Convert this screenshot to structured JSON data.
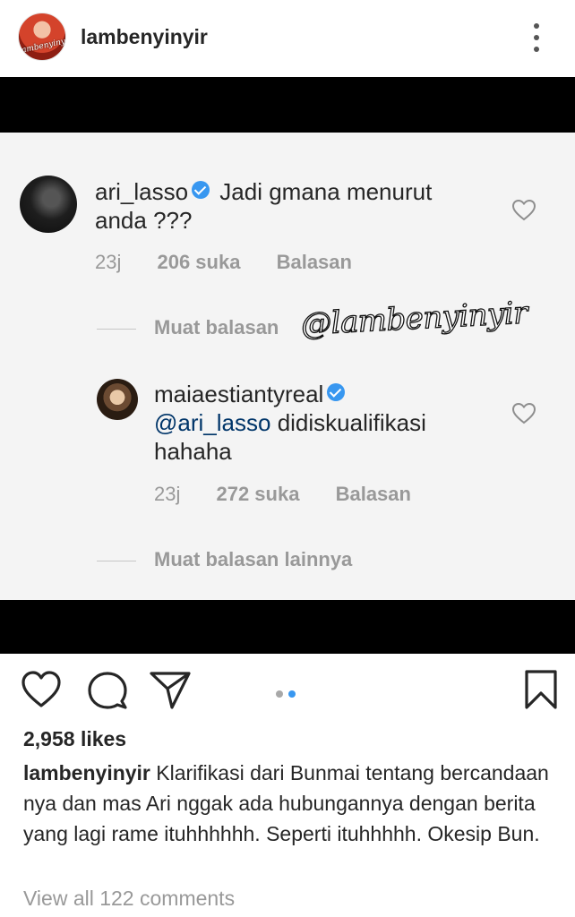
{
  "post": {
    "username": "lambenyinyir",
    "avatar_logo_text": "lambenyinyir",
    "more_icon": "more-vertical-icon"
  },
  "screenshot": {
    "watermark": "@lambenyinyir",
    "comments": [
      {
        "user": "ari_lasso",
        "verified": true,
        "text": "Jadi gmana menurut",
        "text_line2": "anda ???",
        "time": "23j",
        "likes": "206 suka",
        "reply": "Balasan"
      },
      {
        "user": "maiaestiantyreal",
        "verified": true,
        "mention": "@ari_lasso",
        "text": "didiskualifikasi",
        "text_line2": "hahaha",
        "time": "23j",
        "likes": "272 suka",
        "reply": "Balasan"
      }
    ],
    "load_more_1": "Muat balasan",
    "load_more_2": "Muat balasan lainnya"
  },
  "actions": {
    "like_icon": "heart-icon",
    "comment_icon": "comment-icon",
    "share_icon": "send-icon",
    "save_icon": "bookmark-icon",
    "carousel_active_color": "#3897f0"
  },
  "likes": "2,958 likes",
  "caption": {
    "user": "lambenyinyir",
    "text": "Klarifikasi dari Bunmai tentang bercandaan nya dan mas Ari nggak ada hubungannya dengan berita yang lagi rame ituhhhhhh. Seperti ituhhhhh. Okesip Bun."
  },
  "view_comments": "View all 122 comments"
}
